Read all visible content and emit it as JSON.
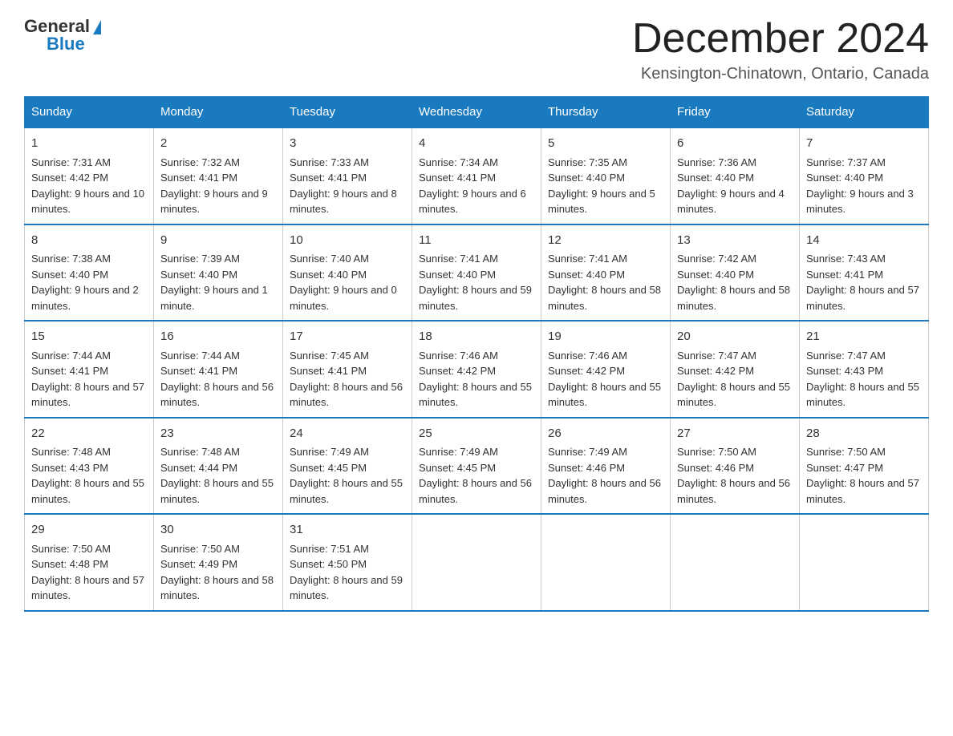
{
  "header": {
    "logo": {
      "general": "General",
      "blue": "Blue"
    },
    "title": "December 2024",
    "location": "Kensington-Chinatown, Ontario, Canada"
  },
  "days_of_week": [
    "Sunday",
    "Monday",
    "Tuesday",
    "Wednesday",
    "Thursday",
    "Friday",
    "Saturday"
  ],
  "weeks": [
    [
      {
        "day": "1",
        "sunrise": "7:31 AM",
        "sunset": "4:42 PM",
        "daylight": "9 hours and 10 minutes."
      },
      {
        "day": "2",
        "sunrise": "7:32 AM",
        "sunset": "4:41 PM",
        "daylight": "9 hours and 9 minutes."
      },
      {
        "day": "3",
        "sunrise": "7:33 AM",
        "sunset": "4:41 PM",
        "daylight": "9 hours and 8 minutes."
      },
      {
        "day": "4",
        "sunrise": "7:34 AM",
        "sunset": "4:41 PM",
        "daylight": "9 hours and 6 minutes."
      },
      {
        "day": "5",
        "sunrise": "7:35 AM",
        "sunset": "4:40 PM",
        "daylight": "9 hours and 5 minutes."
      },
      {
        "day": "6",
        "sunrise": "7:36 AM",
        "sunset": "4:40 PM",
        "daylight": "9 hours and 4 minutes."
      },
      {
        "day": "7",
        "sunrise": "7:37 AM",
        "sunset": "4:40 PM",
        "daylight": "9 hours and 3 minutes."
      }
    ],
    [
      {
        "day": "8",
        "sunrise": "7:38 AM",
        "sunset": "4:40 PM",
        "daylight": "9 hours and 2 minutes."
      },
      {
        "day": "9",
        "sunrise": "7:39 AM",
        "sunset": "4:40 PM",
        "daylight": "9 hours and 1 minute."
      },
      {
        "day": "10",
        "sunrise": "7:40 AM",
        "sunset": "4:40 PM",
        "daylight": "9 hours and 0 minutes."
      },
      {
        "day": "11",
        "sunrise": "7:41 AM",
        "sunset": "4:40 PM",
        "daylight": "8 hours and 59 minutes."
      },
      {
        "day": "12",
        "sunrise": "7:41 AM",
        "sunset": "4:40 PM",
        "daylight": "8 hours and 58 minutes."
      },
      {
        "day": "13",
        "sunrise": "7:42 AM",
        "sunset": "4:40 PM",
        "daylight": "8 hours and 58 minutes."
      },
      {
        "day": "14",
        "sunrise": "7:43 AM",
        "sunset": "4:41 PM",
        "daylight": "8 hours and 57 minutes."
      }
    ],
    [
      {
        "day": "15",
        "sunrise": "7:44 AM",
        "sunset": "4:41 PM",
        "daylight": "8 hours and 57 minutes."
      },
      {
        "day": "16",
        "sunrise": "7:44 AM",
        "sunset": "4:41 PM",
        "daylight": "8 hours and 56 minutes."
      },
      {
        "day": "17",
        "sunrise": "7:45 AM",
        "sunset": "4:41 PM",
        "daylight": "8 hours and 56 minutes."
      },
      {
        "day": "18",
        "sunrise": "7:46 AM",
        "sunset": "4:42 PM",
        "daylight": "8 hours and 55 minutes."
      },
      {
        "day": "19",
        "sunrise": "7:46 AM",
        "sunset": "4:42 PM",
        "daylight": "8 hours and 55 minutes."
      },
      {
        "day": "20",
        "sunrise": "7:47 AM",
        "sunset": "4:42 PM",
        "daylight": "8 hours and 55 minutes."
      },
      {
        "day": "21",
        "sunrise": "7:47 AM",
        "sunset": "4:43 PM",
        "daylight": "8 hours and 55 minutes."
      }
    ],
    [
      {
        "day": "22",
        "sunrise": "7:48 AM",
        "sunset": "4:43 PM",
        "daylight": "8 hours and 55 minutes."
      },
      {
        "day": "23",
        "sunrise": "7:48 AM",
        "sunset": "4:44 PM",
        "daylight": "8 hours and 55 minutes."
      },
      {
        "day": "24",
        "sunrise": "7:49 AM",
        "sunset": "4:45 PM",
        "daylight": "8 hours and 55 minutes."
      },
      {
        "day": "25",
        "sunrise": "7:49 AM",
        "sunset": "4:45 PM",
        "daylight": "8 hours and 56 minutes."
      },
      {
        "day": "26",
        "sunrise": "7:49 AM",
        "sunset": "4:46 PM",
        "daylight": "8 hours and 56 minutes."
      },
      {
        "day": "27",
        "sunrise": "7:50 AM",
        "sunset": "4:46 PM",
        "daylight": "8 hours and 56 minutes."
      },
      {
        "day": "28",
        "sunrise": "7:50 AM",
        "sunset": "4:47 PM",
        "daylight": "8 hours and 57 minutes."
      }
    ],
    [
      {
        "day": "29",
        "sunrise": "7:50 AM",
        "sunset": "4:48 PM",
        "daylight": "8 hours and 57 minutes."
      },
      {
        "day": "30",
        "sunrise": "7:50 AM",
        "sunset": "4:49 PM",
        "daylight": "8 hours and 58 minutes."
      },
      {
        "day": "31",
        "sunrise": "7:51 AM",
        "sunset": "4:50 PM",
        "daylight": "8 hours and 59 minutes."
      },
      null,
      null,
      null,
      null
    ]
  ]
}
